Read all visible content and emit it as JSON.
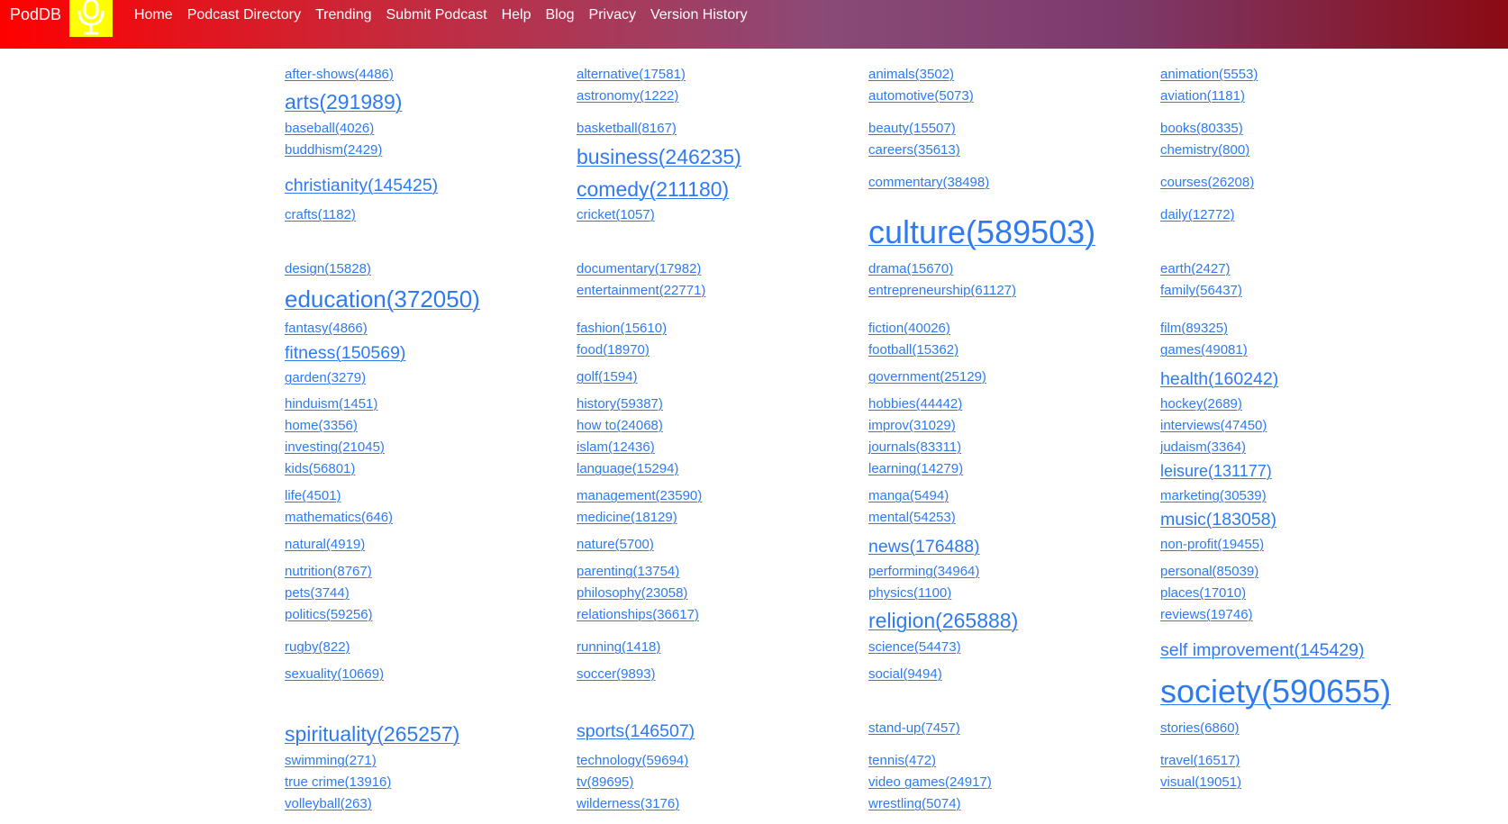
{
  "header": {
    "brand": "PodDB",
    "logo_icon": "microphone-icon",
    "nav": [
      "Home",
      "Podcast Directory",
      "Trending",
      "Submit Podcast",
      "Help",
      "Blog",
      "Privacy",
      "Version History"
    ]
  },
  "colors": {
    "link": "#2e7af0",
    "logo_bg": "#ffff00",
    "nav_text": "#ffffff"
  },
  "columns": [
    [
      "after-shows(4486)",
      "arts(291989)",
      "baseball(4026)",
      "buddhism(2429)",
      "christianity(145425)",
      "crafts(1182)",
      "design(15828)",
      "education(372050)",
      "fantasy(4866)",
      "fitness(150569)",
      "garden(3279)",
      "hinduism(1451)",
      "home(3356)",
      "investing(21045)",
      "kids(56801)",
      "life(4501)",
      "mathematics(646)",
      "natural(4919)",
      "nutrition(8767)",
      "pets(3744)",
      "politics(59256)",
      "rugby(822)",
      "sexuality(10669)",
      "spirituality(265257)",
      "swimming(271)",
      "true crime(13916)",
      "volleyball(263)"
    ],
    [
      "alternative(17581)",
      "astronomy(1222)",
      "basketball(8167)",
      "business(246235)",
      "comedy(211180)",
      "cricket(1057)",
      "documentary(17982)",
      "entertainment(22771)",
      "fashion(15610)",
      "food(18970)",
      "golf(1594)",
      "history(59387)",
      "how to(24068)",
      "islam(12436)",
      "language(15294)",
      "management(23590)",
      "medicine(18129)",
      "nature(5700)",
      "parenting(13754)",
      "philosophy(23058)",
      "relationships(36617)",
      "running(1418)",
      "soccer(9893)",
      "sports(146507)",
      "technology(59694)",
      "tv(89695)",
      "wilderness(3176)"
    ],
    [
      "animals(3502)",
      "automotive(5073)",
      "beauty(15507)",
      "careers(35613)",
      "commentary(38498)",
      "culture(589503)",
      "drama(15670)",
      "entrepreneurship(61127)",
      "fiction(40026)",
      "football(15362)",
      "government(25129)",
      "hobbies(44442)",
      "improv(31029)",
      "journals(83311)",
      "learning(14279)",
      "manga(5494)",
      "mental(54253)",
      "news(176488)",
      "performing(34964)",
      "physics(1100)",
      "religion(265888)",
      "science(54473)",
      "social(9494)",
      "stand-up(7457)",
      "tennis(472)",
      "video games(24917)",
      "wrestling(5074)"
    ],
    [
      "animation(5553)",
      "aviation(1181)",
      "books(80335)",
      "chemistry(800)",
      "courses(26208)",
      "daily(12772)",
      "earth(2427)",
      "family(56437)",
      "film(89325)",
      "games(49081)",
      "health(160242)",
      "hockey(2689)",
      "interviews(47450)",
      "judaism(3364)",
      "leisure(131177)",
      "marketing(30539)",
      "music(183058)",
      "non-profit(19455)",
      "personal(85039)",
      "places(17010)",
      "reviews(19746)",
      "self improvement(145429)",
      "society(590655)",
      "stories(6860)",
      "travel(16517)",
      "visual(19051)"
    ]
  ]
}
